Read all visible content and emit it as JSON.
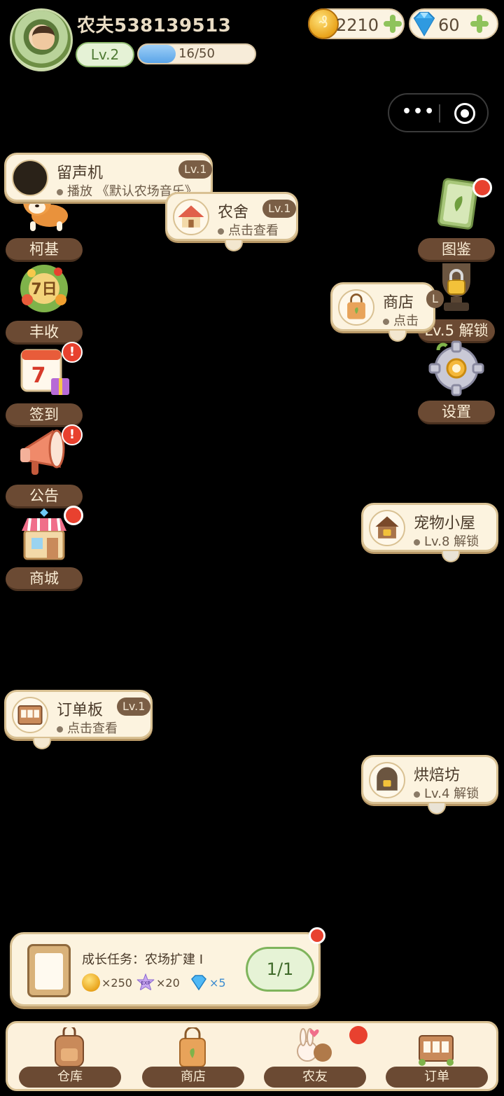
{
  "header": {
    "username": "农夫538139513",
    "level": "Lv.2",
    "xp_text": "16/50",
    "xp_fraction": 0.32,
    "coins": "2210",
    "gems": "60"
  },
  "left_menu": [
    {
      "label": "柯基"
    },
    {
      "label": "丰收",
      "icon_text": "7日"
    },
    {
      "label": "签到",
      "icon_text": "7"
    },
    {
      "label": "公告"
    },
    {
      "label": "商城"
    }
  ],
  "right_menu": [
    {
      "label": "图鉴"
    },
    {
      "label": "Lv.5 解锁"
    },
    {
      "label": "设置"
    }
  ],
  "cards": {
    "gramophone": {
      "title": "留声机",
      "level": "Lv.1",
      "sub": "播放 《默认农场音乐》"
    },
    "farmhouse": {
      "title": "农舍",
      "level": "Lv.1",
      "sub": "点击查看"
    },
    "shop": {
      "title": "商店",
      "level": "L",
      "sub": "点击"
    },
    "pet_house": {
      "title": "宠物小屋",
      "sub": "Lv.8 解锁"
    },
    "order_board": {
      "title": "订单板",
      "level": "Lv.1",
      "sub": "点击查看"
    },
    "bakery": {
      "title": "烘焙坊",
      "sub": "Lv.4 解锁"
    }
  },
  "quest": {
    "title": "成长任务：农场扩建 I",
    "rewards": [
      {
        "icon": "coin-icon",
        "amount": "×250"
      },
      {
        "icon": "exp-star-icon",
        "amount": "×20",
        "icon_text": "EXP"
      },
      {
        "icon": "diamond-icon",
        "amount": "×5"
      }
    ],
    "progress": "1/1"
  },
  "bottom_nav": [
    {
      "label": "仓库",
      "icon": "backpack-icon"
    },
    {
      "label": "商店",
      "icon": "shopping-bag-icon"
    },
    {
      "label": "农友",
      "icon": "friends-icon"
    },
    {
      "label": "订单",
      "icon": "order-board-icon"
    }
  ],
  "colors": {
    "notification": "#e8412f",
    "label_bg": "#6b4a33",
    "card_bg": "#fcf3df"
  }
}
